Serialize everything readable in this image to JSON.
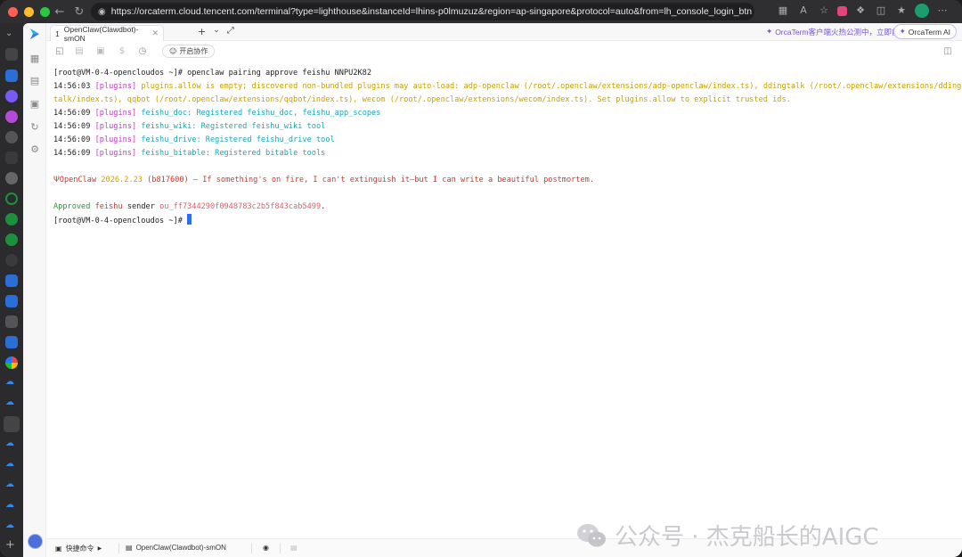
{
  "browser": {
    "url": "https://orcaterm.cloud.tencent.com/terminal?type=lighthouse&instanceId=lhins-p0lmuzuz&region=ap-singapore&protocol=auto&from=lh_console_login_btn"
  },
  "app": {
    "tab": {
      "index": "1",
      "label": "OpenClaw(Clawdbot)-smON"
    },
    "promo_text": "OrcaTerm客户端火热公测中，立即前往",
    "ai_button_label": "OrcaTerm AI",
    "collab_label": "开启协作"
  },
  "terminal": {
    "prompt": "[root@VM-0-4-opencloudos ~]#",
    "command": "openclaw pairing approve feishu NNPU2K82",
    "logs": [
      {
        "time": "14:56:03",
        "tag": "[plugins]",
        "msg": "plugins.allow is empty; discovered non-bundled plugins may auto-load: adp-openclaw (/root/.openclaw/extensions/adp-openclaw/index.ts), ddingtalk (/root/.openclaw/extensions/dding",
        "msg_cont": "talk/index.ts), qqbot (/root/.openclaw/extensions/qqbot/index.ts), wecom (/root/.openclaw/extensions/wecom/index.ts). Set plugins.allow to explicit trusted ids."
      },
      {
        "time": "14:56:09",
        "tag": "[plugins]",
        "msg": "feishu_doc: Registered feishu_doc, feishu_app_scopes"
      },
      {
        "time": "14:56:09",
        "tag": "[plugins]",
        "msg": "feishu_wiki: Registered feishu_wiki tool"
      },
      {
        "time": "14:56:09",
        "tag": "[plugins]",
        "msg": "feishu_drive: Registered feishu_drive tool"
      },
      {
        "time": "14:56:09",
        "tag": "[plugins]",
        "msg": "feishu_bitable: Registered bitable tools"
      }
    ],
    "banner": {
      "name": "OpenClaw",
      "version": "2026.2.23",
      "build": "(b817600)",
      "tagline": "— If something's on fire, I can't extinguish it—but I can write a beautiful postmortem."
    },
    "approved": {
      "word": "Approved",
      "channel": "feishu",
      "sender_word": "sender",
      "sender_id": "ou_ff7344290f0948783c2b5f843cab5499",
      "period": "."
    }
  },
  "status_bar": {
    "quick_commands": "快捷命令",
    "session": "OpenClaw(Clawdbot)-smON"
  },
  "watermark": "公众号 · 杰克船长的AIGC",
  "colors": {
    "accent": "#2d6ff2",
    "brand_purple": "#7a4fe0"
  }
}
